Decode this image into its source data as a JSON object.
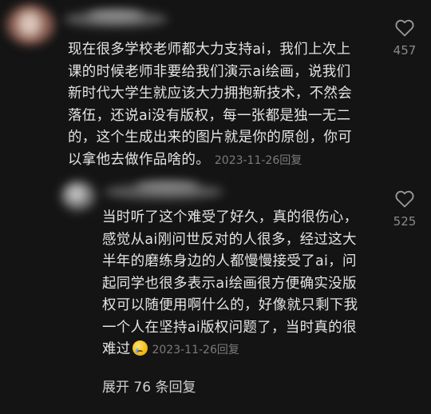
{
  "comment1": {
    "lines": [
      "现在很多学校老师都大力支持ai，我们上次上",
      "课的时候老师非要给我们演示ai绘画，说我们",
      "新时代大学生就应该大力拥抱新技术，不然会",
      "落伍，还说ai没有版权，每一张都是独一无二",
      "的，这个生成出来的图片就是你的原创，你可",
      "以拿他去做作品啥的。"
    ],
    "date": "2023-11-26",
    "reply_label": "回复",
    "likes": "457"
  },
  "comment2": {
    "lines": [
      "当时听了这个难受了好久，真的很伤心，",
      "感觉从ai刚问世反对的人很多，经过这大",
      "半年的磨练身边的人都慢慢接受了ai，问",
      "起同学也很多表示ai绘画很方便确实没版",
      "权可以随便用啊什么的，好像就只剩下我",
      "一个人在坚持ai版权问题了，当时真的很",
      "难过"
    ],
    "emoji": "crying-face",
    "date": "2023-11-26",
    "reply_label": "回复",
    "likes": "525"
  },
  "expand_label": "展开 76 条回复",
  "colors": {
    "background": "#141414",
    "text": "#e4e4e4",
    "meta": "#7b7b7b"
  }
}
